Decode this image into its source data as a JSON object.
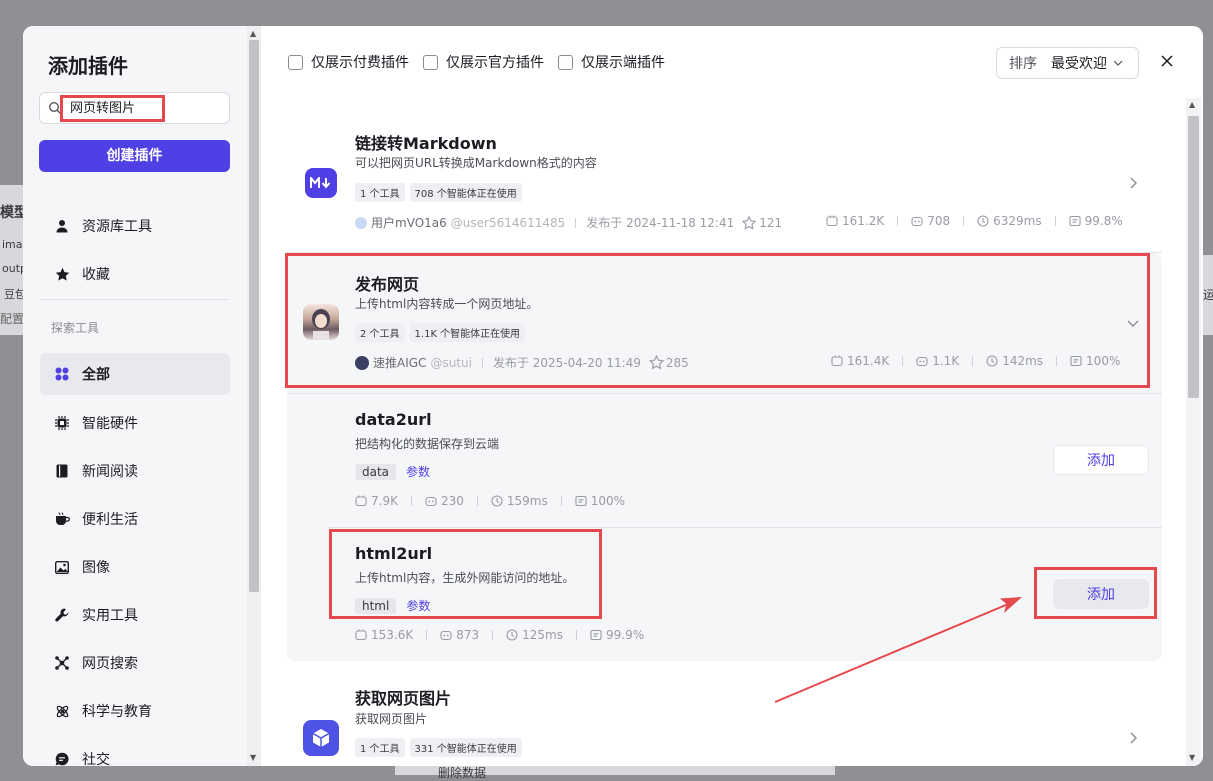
{
  "background": {
    "left_labels": [
      "模型",
      "ima",
      "outp",
      "豆包",
      "配置"
    ],
    "right_label": "运",
    "bottom_label": "删除数据"
  },
  "sidebar": {
    "title": "添加插件",
    "search_value": "网页转图片",
    "create_button": "创建插件",
    "top_items": [
      {
        "label": "资源库工具",
        "icon": "user-icon"
      },
      {
        "label": "收藏",
        "icon": "star-icon"
      }
    ],
    "section_label": "探索工具",
    "categories": [
      {
        "label": "全部",
        "icon": "grid-icon",
        "active": true
      },
      {
        "label": "智能硬件",
        "icon": "chip-icon"
      },
      {
        "label": "新闻阅读",
        "icon": "book-icon"
      },
      {
        "label": "便利生活",
        "icon": "cup-icon"
      },
      {
        "label": "图像",
        "icon": "image-icon"
      },
      {
        "label": "实用工具",
        "icon": "wrench-icon"
      },
      {
        "label": "网页搜索",
        "icon": "network-icon"
      },
      {
        "label": "科学与教育",
        "icon": "atom-icon"
      },
      {
        "label": "社交",
        "icon": "chat-icon"
      }
    ]
  },
  "filters": {
    "paid": "仅展示付费插件",
    "official": "仅展示官方插件",
    "client": "仅展示端插件"
  },
  "sort": {
    "label": "排序",
    "value": "最受欢迎"
  },
  "plugins": [
    {
      "title": "链接转Markdown",
      "desc": "可以把网页URL转换成Markdown格式的内容",
      "tags": [
        "1 个工具",
        "708 个智能体正在使用"
      ],
      "author": "用户mVO1a6",
      "handle": "@user5614611485",
      "published": "发布于 2024-11-18 12:41",
      "stars": "121",
      "calls": "161.2K",
      "bots": "708",
      "latency": "6329ms",
      "success": "99.8%"
    },
    {
      "title": "发布网页",
      "desc": "上传html内容转成一个网页地址。",
      "tags": [
        "2 个工具",
        "1.1K 个智能体正在使用"
      ],
      "author": "速推AIGC",
      "handle": "@sutui",
      "published": "发布于 2025-04-20 11:49",
      "stars": "285",
      "calls": "161.4K",
      "bots": "1.1K",
      "latency": "142ms",
      "success": "100%"
    },
    {
      "title": "获取网页图片",
      "desc": "获取网页图片",
      "tags": [
        "1 个工具",
        "331 个智能体正在使用"
      ]
    }
  ],
  "tools": [
    {
      "name": "data2url",
      "desc": "把结构化的数据保存到云端",
      "param": "data",
      "param_link": "参数",
      "calls": "7.9K",
      "bots": "230",
      "latency": "159ms",
      "success": "100%",
      "add": "添加"
    },
    {
      "name": "html2url",
      "desc": "上传html内容，生成外网能访问的地址。",
      "param": "html",
      "param_link": "参数",
      "calls": "153.6K",
      "bots": "873",
      "latency": "125ms",
      "success": "99.9%",
      "add": "添加"
    }
  ],
  "colors": {
    "accent": "#4e40e5",
    "highlight": "#e5484d"
  }
}
